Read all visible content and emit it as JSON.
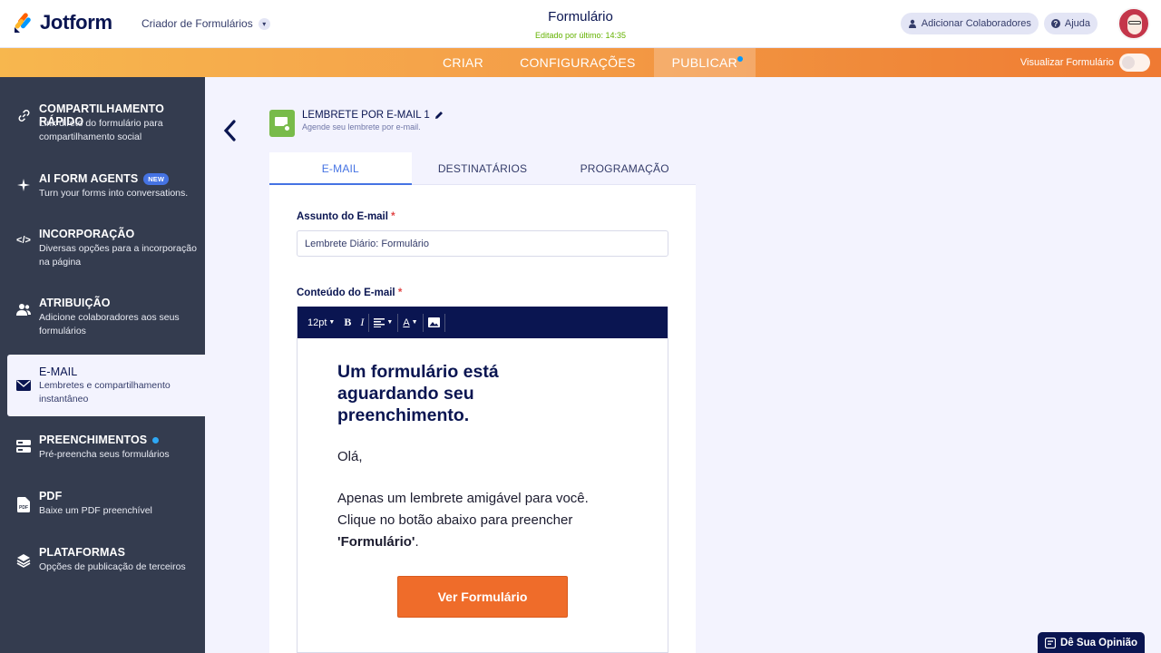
{
  "header": {
    "brand": "Jotform",
    "builder_label": "Criador de Formulários",
    "form_title": "Formulário",
    "edited": "Editado por último: 14:35",
    "add_collaborators": "Adicionar Colaboradores",
    "help": "Ajuda"
  },
  "nav": {
    "tabs": [
      {
        "label": "CRIAR"
      },
      {
        "label": "CONFIGURAÇÕES"
      },
      {
        "label": "PUBLICAR"
      }
    ],
    "preview_label": "Visualizar Formulário"
  },
  "sidebar": {
    "items": [
      {
        "title": "COMPARTILHAMENTO RÁPIDO",
        "desc": "Link direto do formulário para compartilhamento social",
        "icon": "link-icon"
      },
      {
        "title": "AI FORM AGENTS",
        "badge": "NEW",
        "desc": "Turn your forms into conversations.",
        "icon": "sparkle-icon"
      },
      {
        "title": "INCORPORAÇÃO",
        "desc": "Diversas opções para a incorporação na página",
        "icon": "code-icon"
      },
      {
        "title": "ATRIBUIÇÃO",
        "desc": "Adicione colaboradores aos seus formulários",
        "icon": "users-icon"
      },
      {
        "title": "E-MAIL",
        "desc": "Lembretes e compartilhamento instantâneo",
        "icon": "envelope-icon"
      },
      {
        "title": "PREENCHIMENTOS",
        "desc": "Pré-preencha seus formulários",
        "icon": "prefill-icon"
      },
      {
        "title": "PDF",
        "desc": "Baixe um PDF preenchível",
        "icon": "pdf-icon"
      },
      {
        "title": "PLATAFORMAS",
        "desc": "Opções de publicação de terceiros",
        "icon": "layers-icon"
      }
    ]
  },
  "reminder": {
    "title": "LEMBRETE POR E-MAIL 1",
    "subtitle": "Agende seu lembrete por e-mail."
  },
  "tabs": [
    {
      "label": "E-MAIL"
    },
    {
      "label": "DESTINATÁRIOS"
    },
    {
      "label": "PROGRAMAÇÃO"
    }
  ],
  "email": {
    "subject_label": "Assunto do E-mail",
    "subject_value": "Lembrete Diário: Formulário",
    "content_label": "Conteúdo do E-mail",
    "font_size": "12pt",
    "heading": "Um formulário está aguardando seu preenchimento.",
    "greeting": "Olá,",
    "body": "Apenas um lembrete amigável para você. Clique no botão abaixo para preencher ",
    "form_name": "'Formulário'",
    "body_end": ".",
    "button": "Ver Formulário"
  },
  "feedback": "Dê Sua Opinião",
  "colors": {
    "brand_navy": "#0a1551",
    "orange": "#ef6c2a",
    "accent_blue": "#4573e3",
    "sidebar": "#343c4f"
  }
}
